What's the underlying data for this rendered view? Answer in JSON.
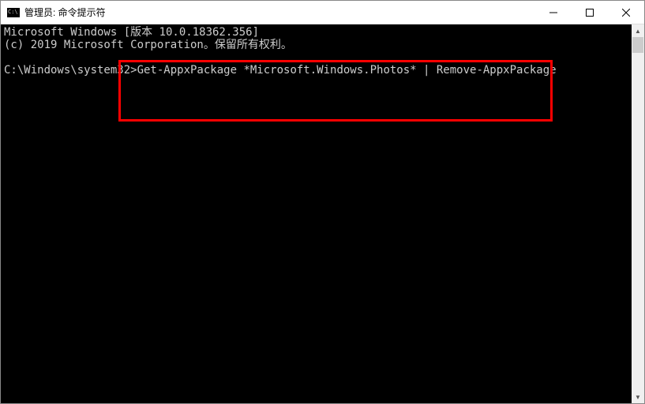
{
  "titlebar": {
    "title": "管理员: 命令提示符"
  },
  "terminal": {
    "line1": "Microsoft Windows [版本 10.0.18362.356]",
    "line2": "(c) 2019 Microsoft Corporation。保留所有权利。",
    "prompt": "C:\\Windows\\system32>",
    "command": "Get-AppxPackage *Microsoft.Windows.Photos* | Remove-AppxPackage"
  },
  "highlight": {
    "color": "#ff0000"
  }
}
